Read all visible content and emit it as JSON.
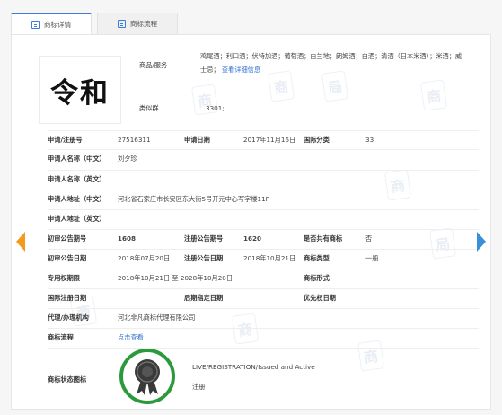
{
  "tabs": [
    {
      "label": "商标详情",
      "active": true
    },
    {
      "label": "商标流程",
      "active": false
    }
  ],
  "trademark": {
    "mark_text": "令和"
  },
  "goods": {
    "label": "商品/服务",
    "value": "鸡尾酒；利口酒；伏特加酒；葡萄酒；白兰地；朗姆酒；白酒；清酒（日本米酒）；米酒；威士忌；",
    "detail_link": "查看详细信息"
  },
  "similar_group": {
    "label": "类似群",
    "value": "3301;"
  },
  "fields": {
    "reg_no_label": "申请/注册号",
    "reg_no": "27516311",
    "apply_date_label": "申请日期",
    "apply_date": "2017年11月16日",
    "intl_class_label": "国际分类",
    "intl_class": "33",
    "applicant_cn_label": "申请人名称（中文）",
    "applicant_cn": "刘夕珍",
    "applicant_en_label": "申请人名称（英文）",
    "applicant_en": "",
    "address_cn_label": "申请人地址（中文）",
    "address_cn": "河北省石家庄市长安区东大街5号开元中心写字楼11F",
    "address_en_label": "申请人地址（英文）",
    "address_en": "",
    "prelim_no_label": "初审公告期号",
    "prelim_no": "1608",
    "reg_pub_no_label": "注册公告期号",
    "reg_pub_no": "1620",
    "shared_label": "是否共有商标",
    "shared": "否",
    "prelim_date_label": "初审公告日期",
    "prelim_date": "2018年07月20日",
    "reg_pub_date_label": "注册公告日期",
    "reg_pub_date": "2018年10月21日",
    "tm_type_label": "商标类型",
    "tm_type": "一般",
    "exclusive_label": "专用权期限",
    "exclusive_period": "2018年10月21日 至 2028年10月20日",
    "tm_form_label": "商标形式",
    "tm_form": "",
    "intl_reg_date_label": "国际注册日期",
    "intl_reg_date": "",
    "later_date_label": "后期指定日期",
    "later_date": "",
    "priority_date_label": "优先权日期",
    "priority_date": "",
    "agent_label": "代理/办理机构",
    "agent": "河北非凡商标代理有限公司",
    "flow_label": "商标流程",
    "flow_link": "点击查看",
    "status_icon_label": "商标状态图标",
    "status_en": "LIVE/REGISTRATION/Issued and Active",
    "status_cn": "注册"
  },
  "colors": {
    "accent": "#3b7dd8",
    "arrow_left": "#f39a1e",
    "arrow_right": "#3b8fd9",
    "status_green": "#2c9a3c"
  }
}
